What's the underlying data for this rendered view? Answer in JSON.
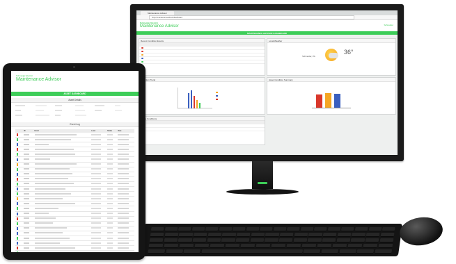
{
  "desktop_app": {
    "browser_tab": "Maintenance Advisor",
    "url": "https://maintenanceadvisor/dashboard",
    "brand_small": "Schneider Electric",
    "title": "Maintenance Advisor",
    "header_right": "Schneider",
    "band_title": "MAINTENANCE ADVISOR DASHBOARD",
    "panels": {
      "events": "Recent Condition Events",
      "weather": "Local Weather",
      "trend": "Condition Trend",
      "summary": "Asset Condition Summary",
      "alarms": "Active Conditions"
    },
    "weather": {
      "location": "Schneider, PA",
      "temp": "36°"
    },
    "colors": {
      "accent": "#3dcd58",
      "bar_red": "#d9372b",
      "bar_orange": "#f5a623",
      "bar_blue": "#3a5fbf"
    }
  },
  "tablet_app": {
    "brand_small": "Schneider Electric",
    "title": "Maintenance Advisor",
    "band_title": "ASSET DASHBOARD",
    "info_section": "Asset Details",
    "events_section": "Event Log",
    "table_headers": [
      "",
      "ID",
      "Event",
      "Level",
      "Status",
      "Date"
    ]
  }
}
